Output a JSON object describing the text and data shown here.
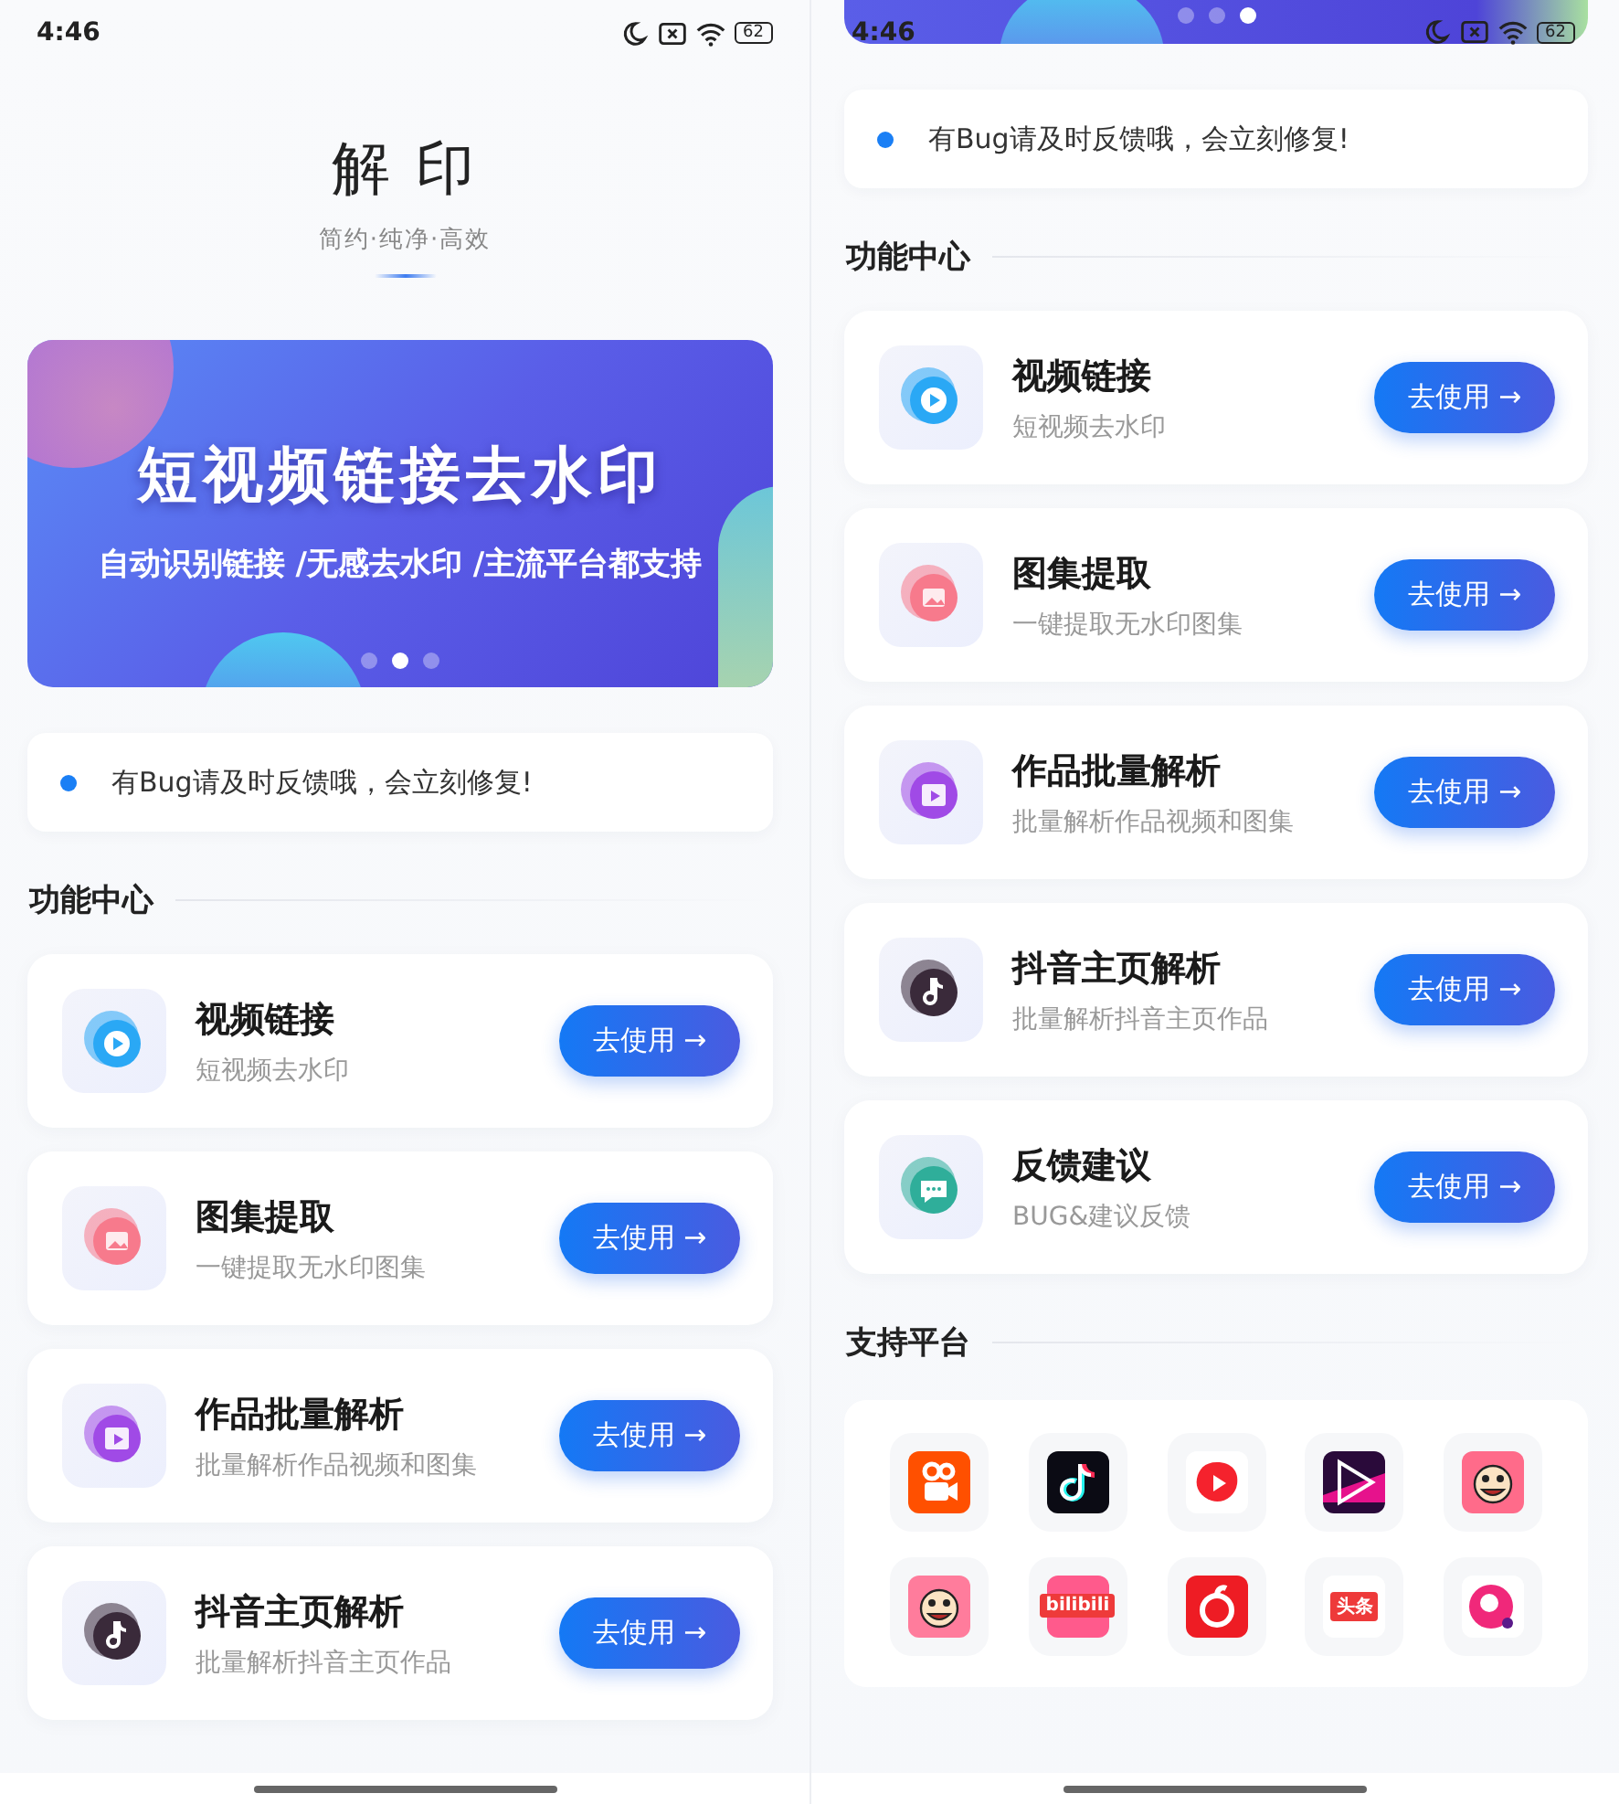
{
  "screens": [
    {
      "status_bar": {
        "time": "4:46",
        "battery": "62"
      },
      "header": {
        "title": "解 印",
        "subtitle": "简约·纯净·高效"
      },
      "banner": {
        "title": "短视频链接去水印",
        "subtitle": "自动识别链接 /无感去水印 /主流平台都支持",
        "dots": [
          {
            "selected": false
          },
          {
            "selected": true
          },
          {
            "selected": false
          }
        ]
      },
      "notice": {
        "text": "有Bug请及时反馈哦，会立刻修复!"
      },
      "section_title": "功能中心",
      "features": [
        {
          "kind": "play",
          "color": "#2aa8f5",
          "title": "视频链接",
          "subtitle": "短视频去水印",
          "button": "去使用 →"
        },
        {
          "kind": "image",
          "color": "#f77a8c",
          "title": "图集提取",
          "subtitle": "一键提取无水印图集",
          "button": "去使用 →"
        },
        {
          "kind": "film",
          "color": "#a04ae6",
          "title": "作品批量解析",
          "subtitle": "批量解析作品视频和图集",
          "button": "去使用 →"
        },
        {
          "kind": "note",
          "color": "#3a2a3a",
          "title": "抖音主页解析",
          "subtitle": "批量解析抖音主页作品",
          "button": "去使用 →"
        }
      ]
    },
    {
      "status_bar": {
        "time": "4:46",
        "battery": "62"
      },
      "banner_strip": {
        "dots": [
          {
            "selected": false
          },
          {
            "selected": false
          },
          {
            "selected": true
          }
        ]
      },
      "notice": {
        "text": "有Bug请及时反馈哦，会立刻修复!"
      },
      "section_title": "功能中心",
      "features": [
        {
          "kind": "play",
          "color": "#2aa8f5",
          "title": "视频链接",
          "subtitle": "短视频去水印",
          "button": "去使用 →"
        },
        {
          "kind": "image",
          "color": "#f77a8c",
          "title": "图集提取",
          "subtitle": "一键提取无水印图集",
          "button": "去使用 →"
        },
        {
          "kind": "film",
          "color": "#a04ae6",
          "title": "作品批量解析",
          "subtitle": "批量解析作品视频和图集",
          "button": "去使用 →"
        },
        {
          "kind": "note",
          "color": "#3a2a3a",
          "title": "抖音主页解析",
          "subtitle": "批量解析抖音主页作品",
          "button": "去使用 →"
        },
        {
          "kind": "chat",
          "color": "#2fae9a",
          "title": "反馈建议",
          "subtitle": "BUG&建议反馈",
          "button": "去使用 →"
        }
      ],
      "platforms_title": "支持平台",
      "platforms": [
        {
          "kind": "camera",
          "color": "#ff5000"
        },
        {
          "kind": "note",
          "color": "#0b0b14"
        },
        {
          "kind": "play-blob",
          "color": "#ffffff"
        },
        {
          "kind": "play-outline",
          "color": "#2a0a3a"
        },
        {
          "kind": "face",
          "color": "#ff6b8a"
        },
        {
          "kind": "face",
          "color": "#ff7c9c"
        },
        {
          "kind": "label",
          "color": "#ff5a8c",
          "label": "bilibili"
        },
        {
          "kind": "swirl",
          "color": "#ee1c24"
        },
        {
          "kind": "label",
          "color": "#ffffff",
          "label": "头条"
        },
        {
          "kind": "bubble",
          "color": "#ffffff"
        }
      ]
    }
  ]
}
